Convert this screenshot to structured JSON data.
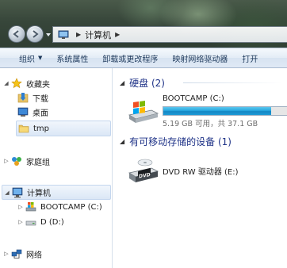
{
  "address": {
    "location": "计算机"
  },
  "commandbar": {
    "items": [
      "组织",
      "系统属性",
      "卸载或更改程序",
      "映射网络驱动器",
      "打开"
    ]
  },
  "navpane": {
    "favorites": {
      "label": "收藏夹",
      "items": [
        {
          "label": "下载",
          "icon": "downloads-folder-icon"
        },
        {
          "label": "桌面",
          "icon": "desktop-icon"
        },
        {
          "label": "tmp",
          "icon": "folder-icon"
        }
      ]
    },
    "homegroup": {
      "label": "家庭组"
    },
    "computer": {
      "label": "计算机",
      "items": [
        {
          "label": "BOOTCAMP (C:)",
          "icon": "windows-drive-icon"
        },
        {
          "label": "D (D:)",
          "icon": "drive-icon"
        }
      ]
    },
    "network": {
      "label": "网络"
    }
  },
  "content": {
    "groups": {
      "hdd": {
        "label": "硬盘 (2)"
      },
      "removable": {
        "label": "有可移动存储的设备 (1)"
      }
    },
    "drives": [
      {
        "name": "BOOTCAMP (C:)",
        "info": "5.19 GB 可用，共 37.1 GB",
        "used_fraction": 0.86,
        "icon": "windows-hard-drive-icon"
      },
      {
        "name": "DVD RW 驱动器 (E:)",
        "icon": "dvd-drive-icon",
        "icon_label": "DVD"
      }
    ]
  },
  "colors": {
    "accent": "#1e3287",
    "bar_fill": "#27a8e0",
    "command_text": "#1e395b"
  }
}
